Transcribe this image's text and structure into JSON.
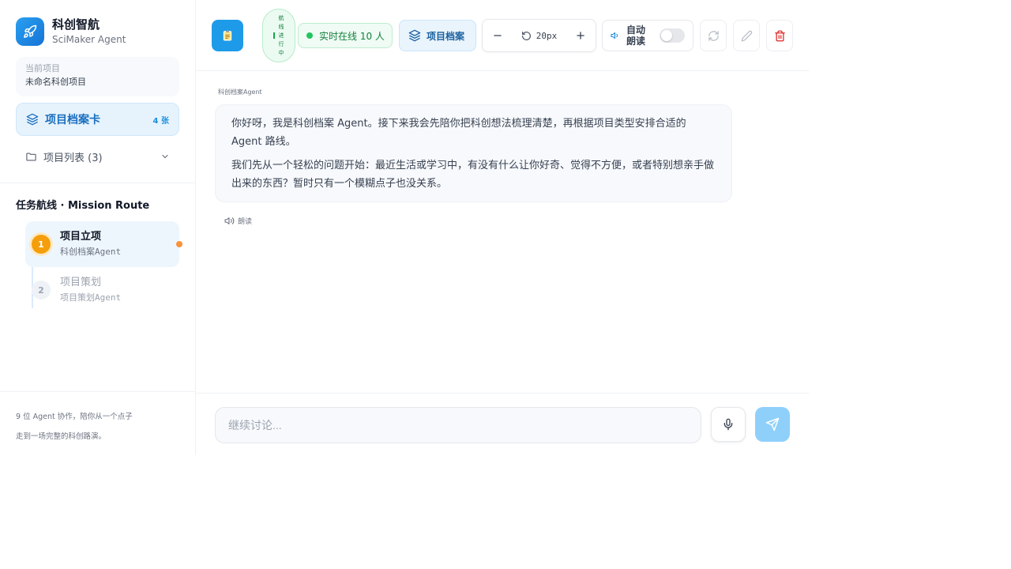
{
  "brand": {
    "name": "科创智航",
    "subtitle": "SciMaker Agent"
  },
  "sidebar": {
    "current_project_label": "当前项目",
    "current_project_value": "未命名科创项目",
    "archive_card_label": "项目档案卡",
    "archive_card_count": "4 张",
    "project_list_label": "项目列表 (3)",
    "route_title": "任务航线 · Mission Route",
    "steps": [
      {
        "num": "1",
        "title": "项目立项",
        "subtitle": "科创档案Agent"
      },
      {
        "num": "2",
        "title": "项目策划",
        "subtitle": "项目策划Agent"
      }
    ],
    "footer_line1": "9 位 Agent 协作，陪你从一个点子",
    "footer_line2": "走到一场完整的科创路演。"
  },
  "topbar": {
    "mission_status": "航线进行中",
    "online_text": "实时在线 10 人",
    "archive_button": "项目档案",
    "font_size": "20px",
    "autoread_label": "自动朗读"
  },
  "chat": {
    "agent_label": "科创档案Agent",
    "message_p1": "你好呀，我是科创档案 Agent。接下来我会先陪你把科创想法梳理清楚，再根据项目类型安排合适的 Agent 路线。",
    "message_p2": "我们先从一个轻松的问题开始：最近生活或学习中，有没有什么让你好奇、觉得不方便，或者特别想亲手做出来的东西？暂时只有一个模糊点子也没关系。",
    "read_label": "朗读"
  },
  "composer": {
    "placeholder": "继续讨论..."
  },
  "colors": {
    "accent": "#1e9be8",
    "active_step": "#f59e0b",
    "online": "#22c55e",
    "danger": "#dc2626"
  },
  "icons": {
    "brand": "rocket-icon",
    "archive": "layers-icon",
    "project_list": "folder-icon",
    "chevron": "chevron-down-icon",
    "document": "clipboard-icon",
    "minus": "minus-icon",
    "reset": "rotate-ccw-icon",
    "plus": "plus-icon",
    "speaker": "volume-icon",
    "refresh": "refresh-icon",
    "edit": "pencil-icon",
    "delete": "trash-icon",
    "mic": "microphone-icon",
    "send": "send-icon"
  },
  "state": {
    "autoread_enabled": false
  }
}
